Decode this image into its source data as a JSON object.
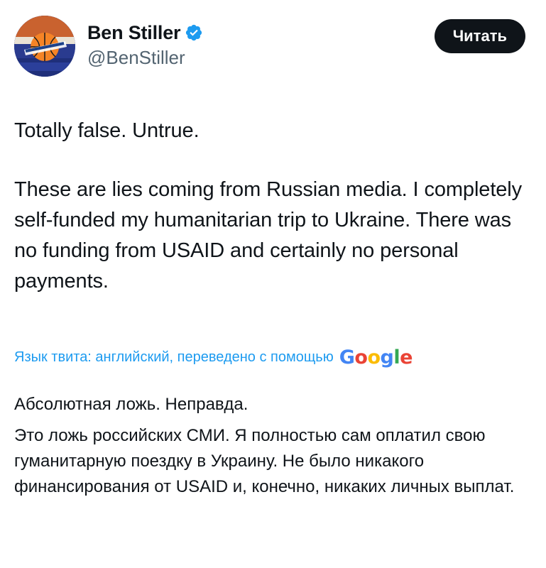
{
  "author": {
    "display_name": "Ben Stiller",
    "handle": "@BenStiller",
    "verified": true,
    "avatar_icon": "knicks-logo-avatar"
  },
  "actions": {
    "read_label": "Читать"
  },
  "tweet": {
    "paragraphs": [
      "Totally false. Untrue.",
      "These are lies coming from Russian media. I completely self-funded my humanitarian trip to Ukraine. There was no funding from USAID and certainly no personal payments."
    ]
  },
  "translation": {
    "notice": "Язык твита: английский, переведено с помощью",
    "provider": [
      "G",
      "o",
      "o",
      "g",
      "l",
      "e"
    ],
    "paragraphs": [
      "Абсолютная ложь. Неправда.",
      "Это ложь российских СМИ. Я полностью сам оплатил свою гуманитарную поездку в Украину. Не было никакого финансирования от USAID и, конечно, никаких личных выплат."
    ]
  },
  "colors": {
    "text": "#0f1419",
    "secondary": "#536471",
    "link": "#1d9bf0",
    "verified": "#1d9bf0",
    "google_blue": "#4285f4",
    "google_red": "#ea4335",
    "google_yellow": "#fbbc05",
    "google_green": "#34a853"
  }
}
